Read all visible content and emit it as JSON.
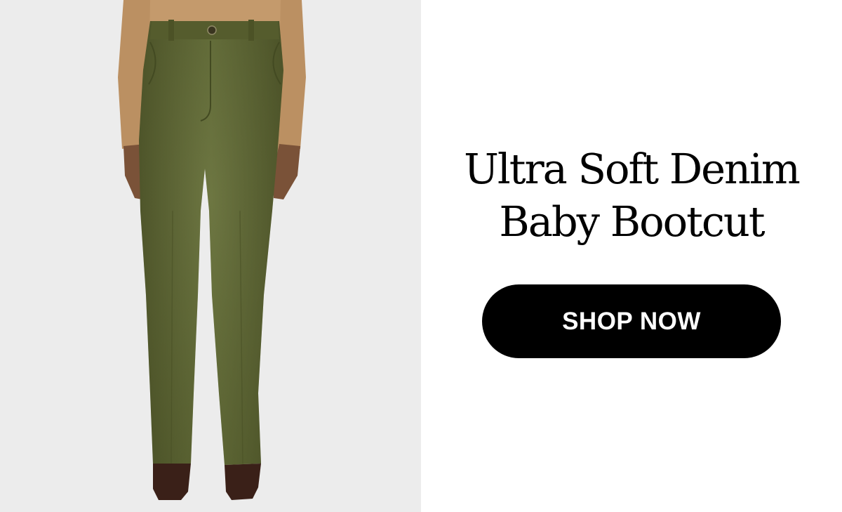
{
  "product": {
    "title_line_1": "Ultra Soft Denim",
    "title_line_2": "Baby Bootcut",
    "image_alt": "Model wearing olive green bootcut denim pants with a tan sweater and dark brown boots"
  },
  "cta": {
    "label": "SHOP NOW"
  },
  "colors": {
    "photo_background": "#ececec",
    "pants": "#5e6535",
    "sweater": "#c49a6c",
    "boots": "#3a2018",
    "button_background": "#000000",
    "button_text": "#ffffff"
  }
}
